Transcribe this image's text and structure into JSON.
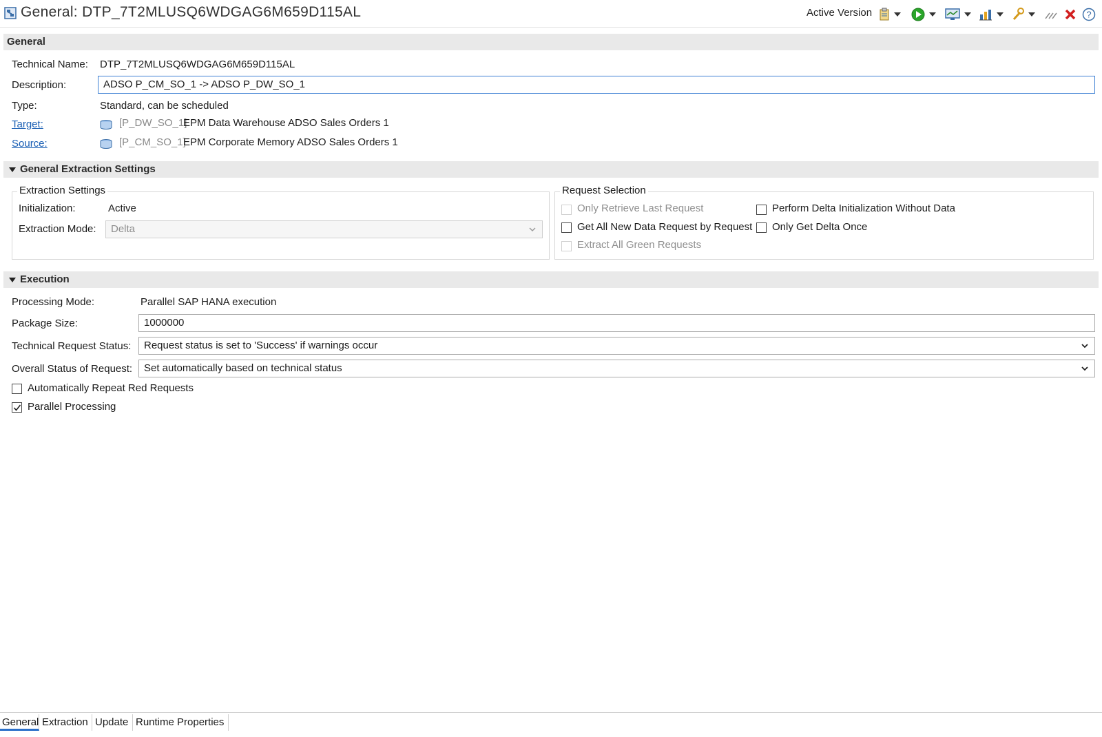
{
  "editor": {
    "title": "General: DTP_7T2MLUSQ6WDGAG6M659D115AL",
    "version_label": "Active Version",
    "toolbar_icons": [
      "clipboard-icon",
      "activate-run-icon",
      "monitor-icon",
      "chart-icon",
      "wrench-icon",
      "slashes-icon",
      "delete-icon",
      "help-icon"
    ]
  },
  "general": {
    "section_title": "General",
    "technical_name_label": "Technical Name:",
    "technical_name": "DTP_7T2MLUSQ6WDGAG6M659D115AL",
    "description_label": "Description:",
    "description": "ADSO P_CM_SO_1 -> ADSO P_DW_SO_1",
    "type_label": "Type:",
    "type": "Standard, can be scheduled",
    "target_label": "Target:",
    "target_code": "[P_DW_SO_1]",
    "target_name": "EPM Data Warehouse ADSO Sales Orders 1",
    "source_label": "Source:",
    "source_code": "[P_CM_SO_1]",
    "source_name": "EPM Corporate Memory ADSO Sales Orders 1"
  },
  "extraction": {
    "section_title": "General Extraction Settings",
    "settings_group_title": "Extraction Settings",
    "initialization_label": "Initialization:",
    "initialization": "Active",
    "mode_label": "Extraction Mode:",
    "mode": "Delta",
    "request_group_title": "Request Selection",
    "options": [
      {
        "label": "Only Retrieve Last Request",
        "checked": false,
        "enabled": false
      },
      {
        "label": "Get All New Data Request by Request",
        "checked": false,
        "enabled": true
      },
      {
        "label": "Extract All Green Requests",
        "checked": false,
        "enabled": false
      },
      {
        "label": "Perform Delta Initialization Without Data",
        "checked": false,
        "enabled": true
      },
      {
        "label": "Only Get Delta Once",
        "checked": false,
        "enabled": true
      }
    ]
  },
  "execution": {
    "section_title": "Execution",
    "processing_mode_label": "Processing Mode:",
    "processing_mode": "Parallel SAP HANA execution",
    "package_size_label": "Package Size:",
    "package_size": "1000000",
    "tech_status_label": "Technical Request Status:",
    "tech_status": "Request status is set to 'Success' if warnings occur",
    "overall_status_label": "Overall Status of Request:",
    "overall_status": "Set automatically based on technical status",
    "auto_repeat_label": "Automatically Repeat Red Requests",
    "auto_repeat_checked": false,
    "parallel_label": "Parallel Processing",
    "parallel_checked": true
  },
  "tabs": [
    {
      "label": "General",
      "active": true
    },
    {
      "label": "Extraction",
      "active": false
    },
    {
      "label": "Update",
      "active": false
    },
    {
      "label": "Runtime Properties",
      "active": false
    }
  ],
  "colors": {
    "link": "#1a5fb4",
    "section_bg": "#e9e9e9",
    "focus_border": "#3c7fd3",
    "delete_icon": "#d21f1f",
    "run_icon": "#2aa52a"
  }
}
